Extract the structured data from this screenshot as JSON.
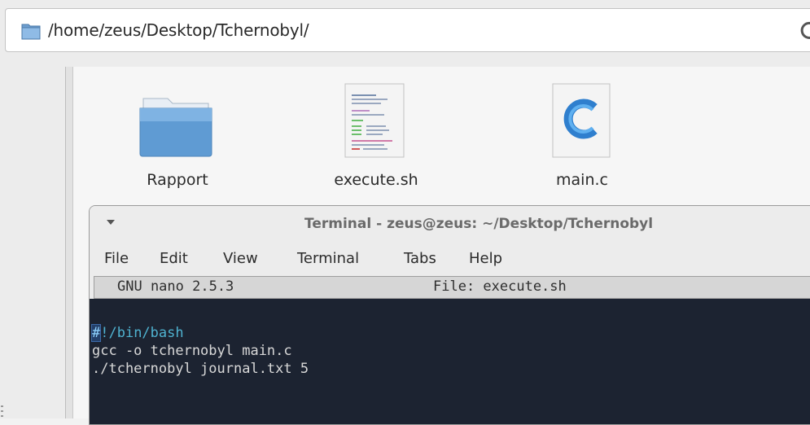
{
  "address_bar": {
    "path": "/home/zeus/Desktop/Tchernobyl/"
  },
  "icon_view": {
    "items": [
      {
        "label": "Rapport",
        "icon": "folder-icon"
      },
      {
        "label": "execute.sh",
        "icon": "shell-script-file-icon"
      },
      {
        "label": "main.c",
        "icon": "c-source-file-icon"
      }
    ]
  },
  "terminal": {
    "title": "Terminal - zeus@zeus: ~/Desktop/Tchernobyl",
    "menu": [
      "File",
      "Edit",
      "View",
      "Terminal",
      "Tabs",
      "Help"
    ],
    "nano": {
      "version": "GNU nano 2.5.3",
      "file_label": "File: execute.sh"
    },
    "lines": {
      "l1_cursor": "#",
      "l1_rest": "!/bin/bash",
      "l2": "gcc -o tchernobyl main.c",
      "l3": "./tchernobyl journal.txt 5"
    }
  },
  "colors": {
    "terminal_bg": "#1c2331",
    "shebang": "#4fb2d0",
    "c_logo": "#3b8fd6"
  }
}
